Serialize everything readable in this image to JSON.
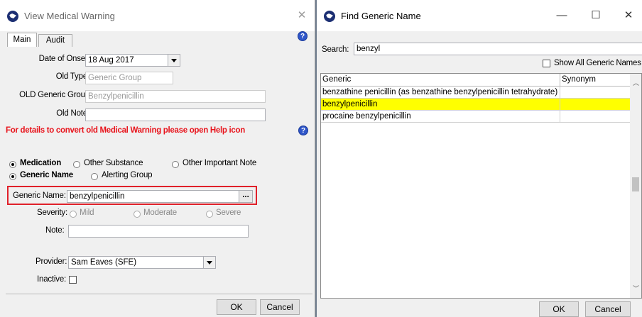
{
  "left_window": {
    "title": "View Medical Warning",
    "close_glyph": "✕",
    "tabs": [
      {
        "label": "Main"
      },
      {
        "label": "Audit"
      }
    ],
    "date_of_onset": {
      "label": "Date of Onset:",
      "value": "18 Aug 2017"
    },
    "old_type": {
      "label": "Old Type:",
      "value": "Generic Group"
    },
    "old_generic_group": {
      "label": "OLD Generic Group",
      "value": "Benzylpenicillin"
    },
    "old_note": {
      "label": "Old Note:",
      "value": ""
    },
    "help_message": "For details to convert old Medical Warning please open Help icon",
    "warning_type": {
      "options": [
        {
          "label": "Medication",
          "selected": true
        },
        {
          "label": "Other Substance",
          "selected": false
        },
        {
          "label": "Other Important Note",
          "selected": false
        }
      ]
    },
    "match_type": {
      "options": [
        {
          "label": "Generic Name",
          "selected": true
        },
        {
          "label": "Alerting Group",
          "selected": false
        }
      ]
    },
    "generic_name": {
      "label": "Generic Name:",
      "value": "benzylpenicillin",
      "browse_label": "..."
    },
    "severity": {
      "label": "Severity:",
      "options": [
        {
          "label": "Mild"
        },
        {
          "label": "Moderate"
        },
        {
          "label": "Severe"
        }
      ]
    },
    "note": {
      "label": "Note:",
      "value": ""
    },
    "provider": {
      "label": "Provider:",
      "value": "Sam Eaves (SFE)"
    },
    "inactive": {
      "label": "Inactive:",
      "checked": false
    },
    "ok_label": "OK",
    "cancel_label": "Cancel"
  },
  "right_window": {
    "title": "Find Generic Name",
    "minimize_glyph": "—",
    "maximize_glyph": "☐",
    "close_glyph": "✕",
    "search": {
      "label": "Search:",
      "value": "benzyl"
    },
    "show_all": {
      "label": "Show All Generic Names",
      "checked": false
    },
    "columns": [
      "Generic",
      "Synonym"
    ],
    "rows": [
      {
        "generic": "benzathine penicillin (as benzathine benzylpenicillin tetrahydrate)",
        "synonym": "",
        "selected": false
      },
      {
        "generic": "benzylpenicillin",
        "synonym": "",
        "selected": true
      },
      {
        "generic": "procaine benzylpenicillin",
        "synonym": "",
        "selected": false
      }
    ],
    "ok_label": "OK",
    "cancel_label": "Cancel"
  },
  "colors": {
    "selected_row": "#ffff00",
    "help_text": "#e8141c",
    "highlight_border": "#e0202a"
  }
}
